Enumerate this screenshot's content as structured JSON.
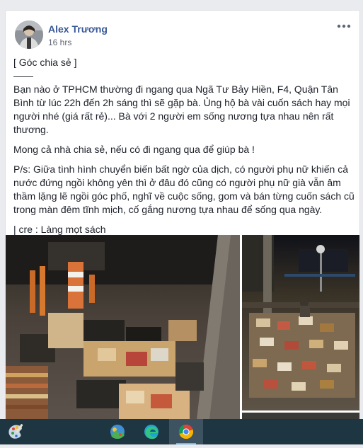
{
  "post": {
    "author": "Alex Trương",
    "timestamp": "16 hrs",
    "paragraphs": [
      "[ Góc chia sẻ ]",
      "——",
      "Bạn nào ở TPHCM thường đi ngang qua Ngã Tư Bảy Hiền, F4, Quận Tân Bình từ lúc 22h đến 2h sáng thì sẽ gặp bà. Ủng hộ bà vài cuốn sách hay mọi người nhé (giá rất rẻ)... Bà với 2 người em sống nương tựa nhau nên rất thương.",
      "Mong cả nhà chia sẻ, nếu có đi ngang qua để giúp bà !",
      "P/s: Giữa tình hình chuyển biến bất ngờ của dịch, có người phụ nữ khiến cả nước đứng ngồi không yên thì ở đâu đó cũng có người phụ nữ già vẫn âm thầm lặng lẽ ngồi góc phố, nghĩ về cuộc sống, gom và bán từng cuốn sách cũ trong màn đêm tĩnh mịch, cố gắng nương tựa nhau để sống qua ngày.",
      "| cre : Làng mọt sách"
    ],
    "icons": {
      "more": "more-options-icon"
    },
    "colors": {
      "author": "#385898",
      "text": "#1d2129",
      "meta": "#616770"
    }
  },
  "taskbar": {
    "icons": [
      "paint-palette-icon",
      "photos-app-icon",
      "edge-browser-icon",
      "chrome-browser-icon"
    ],
    "active": "chrome-browser-icon",
    "colors": {
      "background": "#1e3542",
      "active": "#3d5361"
    }
  }
}
